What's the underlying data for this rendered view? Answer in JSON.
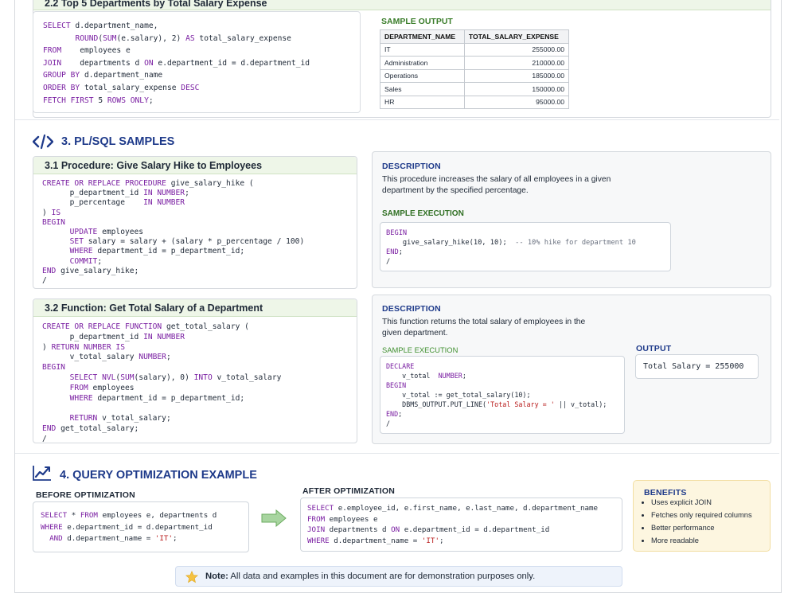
{
  "section2": {
    "subsection_title": "2.2  Top 5 Departments by Total Salary Expense",
    "sample_output_label": "SAMPLE OUTPUT",
    "table_headers": [
      "DEPARTMENT_NAME",
      "TOTAL_SALARY_EXPENSE"
    ],
    "table_rows": [
      [
        "IT",
        "255000.00"
      ],
      [
        "Administration",
        "210000.00"
      ],
      [
        "Operations",
        "185000.00"
      ],
      [
        "Sales",
        "150000.00"
      ],
      [
        "HR",
        "95000.00"
      ]
    ]
  },
  "section3": {
    "title": "3. PL/SQL SAMPLES",
    "icon": "code-icon",
    "proc": {
      "title": "3.1  Procedure: Give Salary Hike to Employees",
      "desc_label": "DESCRIPTION",
      "desc_text": "This procedure increases the salary of all employees in a given department by the specified percentage.",
      "exec_label": "SAMPLE EXECUTION"
    },
    "func": {
      "title": "3.2  Function: Get Total Salary of a Department",
      "desc_label": "DESCRIPTION",
      "desc_text": "This function returns the total salary of employees in the given department.",
      "exec_label": "SAMPLE EXECUTION",
      "output_label": "OUTPUT",
      "output_value": "Total Salary = 255000"
    }
  },
  "section4": {
    "title": "4. QUERY OPTIMIZATION EXAMPLE",
    "icon": "trend-chart-icon",
    "before_label": "BEFORE OPTIMIZATION",
    "after_label": "AFTER OPTIMIZATION",
    "benefits_label": "BENEFITS",
    "benefits": [
      "Uses explicit JOIN",
      "Fetches only required columns",
      "Better performance",
      "More readable"
    ]
  },
  "note": {
    "label": "Note:",
    "text": "All data and examples in this document are for demonstration purposes only.",
    "icon": "star-icon"
  }
}
